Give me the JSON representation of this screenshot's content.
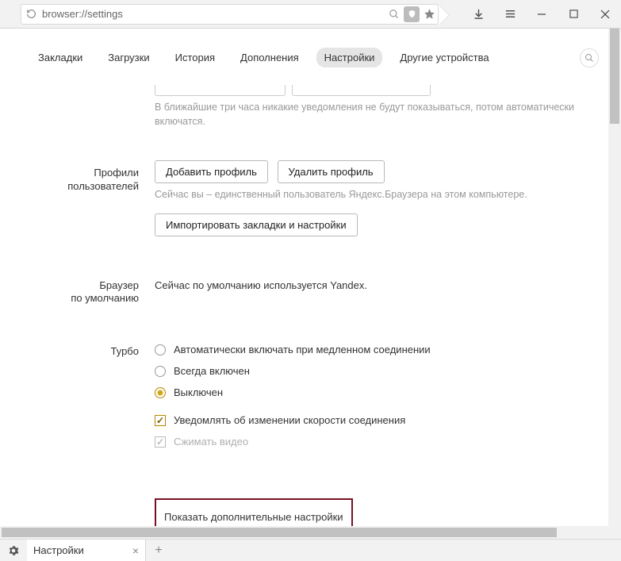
{
  "titlebar": {
    "url": "browser://settings"
  },
  "nav": {
    "tabs": [
      "Закладки",
      "Загрузки",
      "История",
      "Дополнения",
      "Настройки",
      "Другие устройства"
    ],
    "active_index": 4
  },
  "notifications": {
    "desc": "В ближайшие три часа никакие уведомления не будут показываться, потом автоматически включатся."
  },
  "profiles": {
    "label_line1": "Профили",
    "label_line2": "пользователей",
    "add_button": "Добавить профиль",
    "delete_button": "Удалить профиль",
    "desc": "Сейчас вы – единственный пользователь Яндекс.Браузера на этом компьютере.",
    "import_button": "Импортировать закладки и настройки"
  },
  "default_browser": {
    "label_line1": "Браузер",
    "label_line2": "по умолчанию",
    "text": "Сейчас по умолчанию используется Yandex."
  },
  "turbo": {
    "label": "Турбо",
    "options": {
      "auto": "Автоматически включать при медленном соединении",
      "always": "Всегда включен",
      "off": "Выключен"
    },
    "selected": "off",
    "notify": {
      "label": "Уведомлять об изменении скорости соединения",
      "checked": true,
      "enabled": true
    },
    "compress": {
      "label": "Сжимать видео",
      "checked": true,
      "enabled": false
    }
  },
  "advanced": {
    "link": "Показать дополнительные настройки"
  },
  "footer": {
    "tab_title": "Настройки"
  }
}
